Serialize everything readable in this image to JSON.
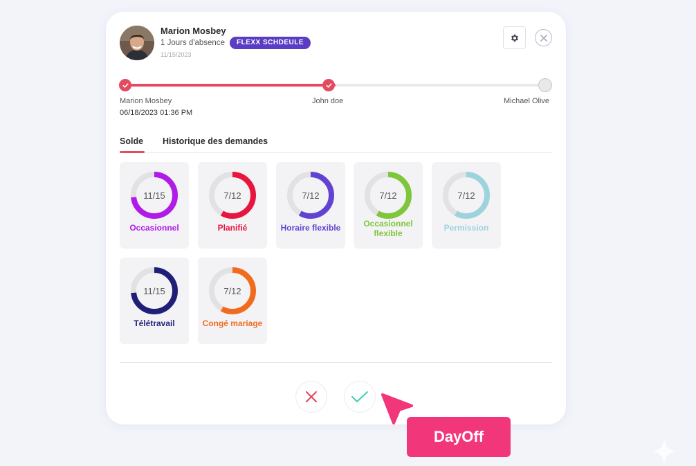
{
  "user": {
    "name": "Marion Mosbey",
    "absence": "1 Jours d'absence",
    "badge": "FLEXX SCHDEULE",
    "date": "11/15/2023"
  },
  "header": {
    "settings_icon": "gear-icon",
    "close_icon": "close-icon"
  },
  "workflow": {
    "progress": 0.5,
    "steps": [
      {
        "label": "Marion Mosbey",
        "status": "done"
      },
      {
        "label": "John doe",
        "status": "done"
      },
      {
        "label": "Michael Olive",
        "status": "pending"
      }
    ],
    "first_step_date": "06/18/2023 01:36 PM"
  },
  "tabs": [
    {
      "label": "Solde",
      "active": true
    },
    {
      "label": "Historique des demandes",
      "active": false
    }
  ],
  "balances": [
    {
      "value": "11/15",
      "used": 11,
      "total": 15,
      "label": "Occasionnel",
      "color": "#b01be8"
    },
    {
      "value": "7/12",
      "used": 7,
      "total": 12,
      "label": "Planifié",
      "color": "#e8153f"
    },
    {
      "value": "7/12",
      "used": 7,
      "total": 12,
      "label": "Horaire flexible",
      "color": "#6243d1"
    },
    {
      "value": "7/12",
      "used": 7,
      "total": 12,
      "label": "Occasionnel flexible",
      "color": "#7fc63a"
    },
    {
      "value": "7/12",
      "used": 7,
      "total": 12,
      "label": "Permission",
      "color": "#9dd3dd"
    },
    {
      "value": "11/15",
      "used": 11,
      "total": 15,
      "label": "Télétravail",
      "color": "#1f1f78"
    },
    {
      "value": "7/12",
      "used": 7,
      "total": 12,
      "label": "Congé mariage",
      "color": "#f26b1d"
    }
  ],
  "actions": {
    "reject_icon": "x-icon",
    "approve_icon": "check-icon"
  },
  "overlay": {
    "label": "DayOff",
    "color": "#f2367a"
  }
}
